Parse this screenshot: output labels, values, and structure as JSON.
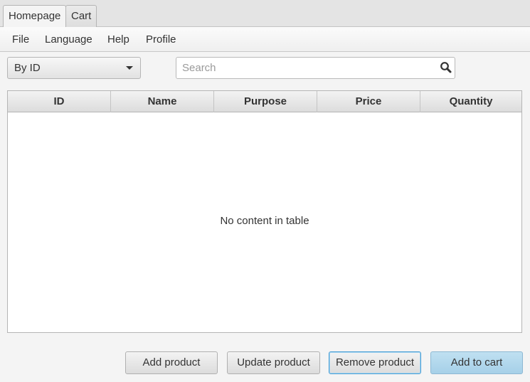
{
  "tabs": [
    {
      "label": "Homepage",
      "active": true
    },
    {
      "label": "Cart",
      "active": false
    }
  ],
  "menu": {
    "file": "File",
    "language": "Language",
    "help": "Help",
    "profile": "Profile"
  },
  "filter": {
    "selected": "By ID"
  },
  "search": {
    "placeholder": "Search",
    "value": "",
    "icon": "search-icon"
  },
  "table": {
    "columns": [
      "ID",
      "Name",
      "Purpose",
      "Price",
      "Quantity"
    ],
    "rows": [],
    "placeholder": "No content in table"
  },
  "actions": {
    "add": "Add product",
    "update": "Update product",
    "remove": "Remove product",
    "add_to_cart": "Add to cart"
  },
  "colors": {
    "accent": "#a6d0e8",
    "focus": "#4a9fd5"
  }
}
